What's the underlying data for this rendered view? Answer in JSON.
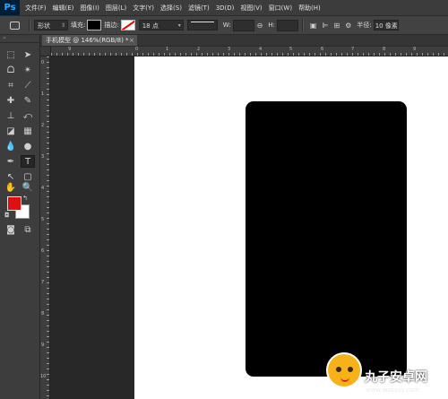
{
  "app": {
    "logo": "Ps"
  },
  "menu": [
    "文件(F)",
    "编辑(E)",
    "图像(I)",
    "图层(L)",
    "文字(Y)",
    "选择(S)",
    "滤镜(T)",
    "3D(D)",
    "视图(V)",
    "窗口(W)",
    "帮助(H)"
  ],
  "options": {
    "mode": "形状",
    "fill_label": "填充:",
    "stroke_label": "描边:",
    "stroke_size": "18 点",
    "w_label": "W:",
    "link_icon": "link-icon",
    "h_label": "H:",
    "radius_label": "半径:",
    "radius_value": "10 像素"
  },
  "document": {
    "tab_title": "手机模型 @ 146%(RGB/8) *",
    "close": "×"
  },
  "rulers": {
    "h": [
      "9",
      "0",
      "1",
      "2",
      "3",
      "4",
      "5",
      "6",
      "7",
      "8",
      "9"
    ],
    "v": [
      "0",
      "1",
      "2",
      "3",
      "4",
      "5",
      "6",
      "7",
      "8",
      "9",
      "10"
    ]
  },
  "colors": {
    "foreground": "#e01010",
    "background": "#ffffff",
    "shape_fill": "#000000"
  },
  "watermark": {
    "title": "丸子安卓网",
    "url": "www.wzsxsy.com"
  }
}
